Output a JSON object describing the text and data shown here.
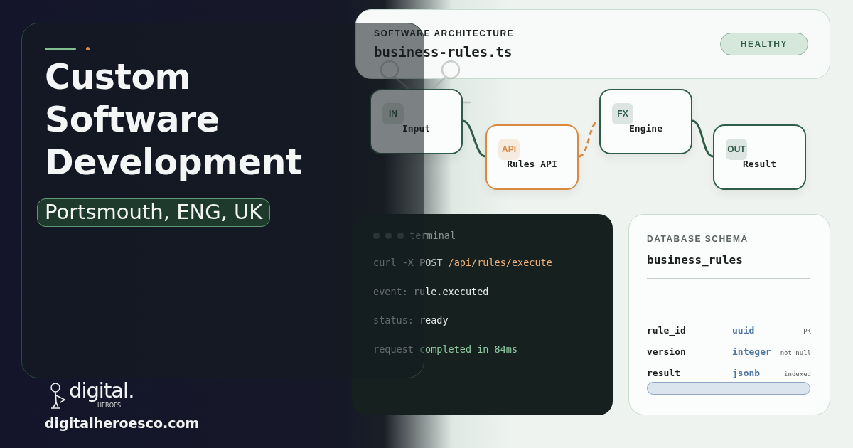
{
  "brand": {
    "title": "Custom Software Development",
    "location": "Portsmouth, ENG, UK",
    "logo_word": "digital.",
    "logo_sub": "HEROES.",
    "url": "digitalheroesco.com"
  },
  "header": {
    "label": "SOFTWARE ARCHITECTURE",
    "file": "business-rules.ts",
    "status": "HEALTHY"
  },
  "flow": {
    "nodes": [
      {
        "badge": "IN",
        "label": "Input",
        "color": "#2f5d4a"
      },
      {
        "badge": "API",
        "label": "Rules API",
        "color": "#d98a3f"
      },
      {
        "badge": "FX",
        "label": "Engine",
        "color": "#2f5d4a"
      },
      {
        "badge": "OUT",
        "label": "Result",
        "color": "#2f5d4a"
      }
    ],
    "links": [
      {
        "kind": "solid"
      },
      {
        "kind": "dashed"
      },
      {
        "kind": "solid"
      }
    ]
  },
  "terminal": {
    "title": "terminal",
    "lines": [
      {
        "key": "curl -X POST",
        "value": "/api/rules/execute",
        "kind": "command"
      },
      {
        "key": "event:",
        "value": "rule.executed",
        "kind": "output"
      },
      {
        "key": "status:",
        "value": "ready",
        "kind": "output"
      },
      {
        "key": "request",
        "value": "completed in 84ms",
        "kind": "success"
      }
    ]
  },
  "schema": {
    "label": "DATABASE SCHEMA",
    "table": "business_rules",
    "columns": [
      {
        "name": "rule_id",
        "type": "uuid",
        "note": "PK"
      },
      {
        "name": "version",
        "type": "integer",
        "note": "not null"
      },
      {
        "name": "result",
        "type": "jsonb",
        "note": "indexed"
      }
    ]
  }
}
